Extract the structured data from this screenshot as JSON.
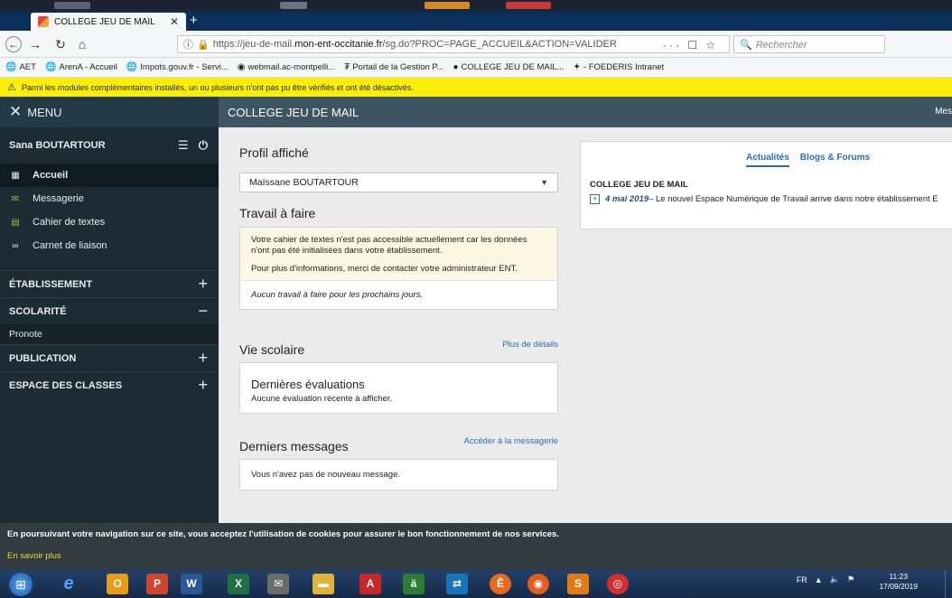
{
  "browser": {
    "tab_title": "COLLEGE JEU DE MAIL",
    "url_prefix": "https://jeu-de-mail.",
    "url_domain": "mon-ent-occitanie.fr",
    "url_suffix": "/sg.do?PROC=PAGE_ACCUEIL&ACTION=VALIDER",
    "url_actions": "··· ☐ ☆",
    "search_placeholder": "Rechercher",
    "bookmarks": [
      {
        "icon": "🌐",
        "label": "AET"
      },
      {
        "icon": "🌐",
        "label": "ArenA - Accueil"
      },
      {
        "icon": "🌐",
        "label": "Impots.gouv.fr - Servi..."
      },
      {
        "icon": "◉",
        "label": "webmail.ac-montpelli..."
      },
      {
        "icon": "₮",
        "label": "Portail de la Gestion P..."
      },
      {
        "icon": "●",
        "label": "COLLEGE JEU DE MAIL..."
      },
      {
        "icon": "✦",
        "label": "- FOEDERIS Intranet"
      }
    ],
    "warning": "Parmi les modules complémentaires installés, un ou plusieurs n'ont pas pu être vérifiés et ont été désactivés."
  },
  "sidebar": {
    "menu_label": "MENU",
    "user": "Sana BOUTARTOUR",
    "nav": [
      {
        "label": "Accueil"
      },
      {
        "label": "Messagerie"
      },
      {
        "label": "Cahier de textes"
      },
      {
        "label": "Carnet de liaison"
      }
    ],
    "sections": [
      {
        "label": "ÉTABLISSEMENT",
        "sign": "+"
      },
      {
        "label": "SCOLARITÉ",
        "sign": "−"
      },
      {
        "label": "PUBLICATION",
        "sign": "+"
      },
      {
        "label": "ESPACE DES CLASSES",
        "sign": "+"
      }
    ],
    "scolarite_sub": "Pronote"
  },
  "main": {
    "header": "COLLEGE JEU DE MAIL",
    "header_right": "Mes",
    "profil_title": "Profil affiché",
    "profil_value": "Maïssane BOUTARTOUR",
    "travail_title": "Travail à faire",
    "travail_notice_1": "Votre cahier de textes n'est pas accessible actuellement car les données n'ont pas été initialisées dans votre établissement.",
    "travail_notice_2": "Pour plus d'informations, merci de contacter votre administrateur ENT.",
    "travail_empty": "Aucun travail à faire pour les prochains jours.",
    "vie_title": "Vie scolaire",
    "vie_link": "Plus de détails",
    "eval_title": "Dernières évaluations",
    "eval_text": "Aucune évaluation récente à afficher.",
    "msg_title": "Derniers messages",
    "msg_link": "Accéder à la messagerie",
    "msg_text": "Vous n'avez pas de nouveau message."
  },
  "news": {
    "tab_actualites": "Actualités",
    "tab_blogs": "Blogs & Forums",
    "org": "COLLEGE JEU DE MAIL",
    "date": "4 mai 2019",
    "text": " – Le nouvel Espace Numérique de Travail arrive dans notre établissement E"
  },
  "cookie": {
    "text": "En poursuivant votre navigation sur ce site, vous acceptez l'utilisation de cookies pour assurer le bon fonctionnement de nos services.",
    "more": "En savoir plus"
  },
  "taskbar": {
    "lang": "FR",
    "time": "11:23",
    "date": "17/09/2019"
  }
}
